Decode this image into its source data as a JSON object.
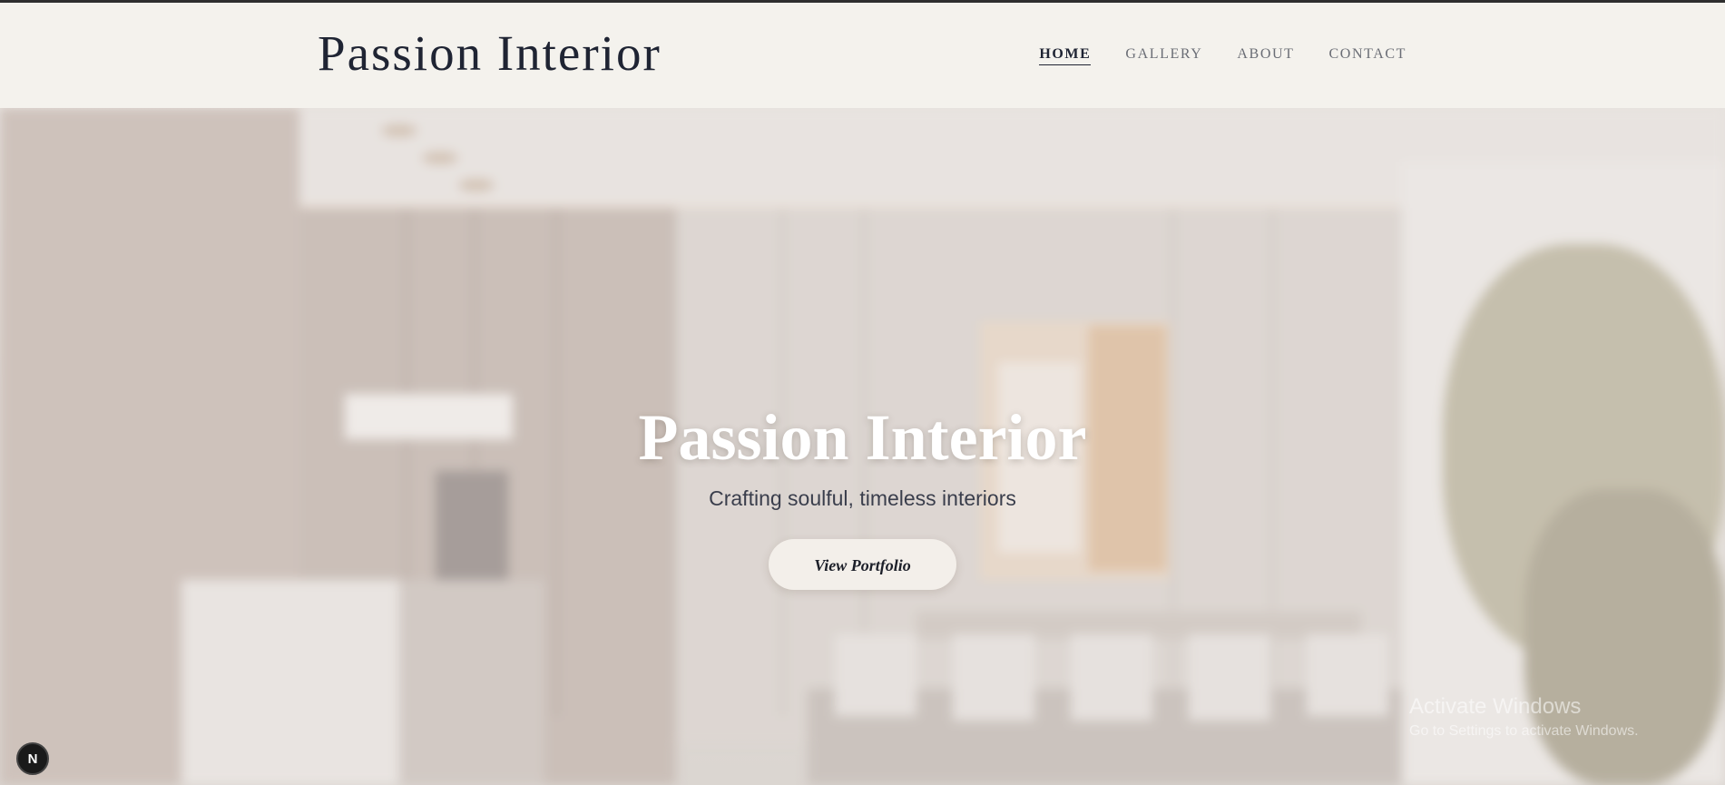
{
  "header": {
    "brand": "Passion Interior",
    "nav": [
      {
        "label": "HOME",
        "active": true
      },
      {
        "label": "GALLERY",
        "active": false
      },
      {
        "label": "ABOUT",
        "active": false
      },
      {
        "label": "CONTACT",
        "active": false
      }
    ]
  },
  "hero": {
    "title": "Passion Interior",
    "subtitle": "Crafting soulful, timeless interiors",
    "cta_label": "View Portfolio"
  },
  "overlay": {
    "watermark_title": "Activate Windows",
    "watermark_subtitle": "Go to Settings to activate Windows.",
    "dev_badge": "N"
  },
  "colors": {
    "header_bg": "#f4f2ed",
    "brand_text": "#1f2433",
    "nav_text": "#6a6d75",
    "hero_title": "#ffffff",
    "subtitle_text": "#3a3e4c",
    "button_bg": "#f3efea"
  },
  "icons": {
    "dev_badge": "nextjs-logo-icon"
  }
}
